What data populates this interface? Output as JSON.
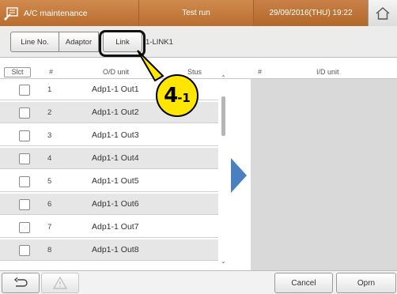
{
  "header": {
    "title": "A/C maintenance",
    "mode": "Test run",
    "datetime": "29/09/2016(THU) 19:22"
  },
  "tabs": {
    "line_no": "Line No.",
    "adaptor": "Adaptor",
    "link": "Link",
    "link_value": "1-LINK1"
  },
  "columns": {
    "slct": "Slct",
    "num": "#",
    "od_unit": "O/D unit",
    "stus": "Stus",
    "num2": "#",
    "id_unit": "I/D unit"
  },
  "rows": [
    {
      "num": "1",
      "unit": "Adp1-1 Out1"
    },
    {
      "num": "2",
      "unit": "Adp1-1 Out2"
    },
    {
      "num": "3",
      "unit": "Adp1-1 Out3"
    },
    {
      "num": "4",
      "unit": "Adp1-1 Out4"
    },
    {
      "num": "5",
      "unit": "Adp1-1 Out5"
    },
    {
      "num": "6",
      "unit": "Adp1-1 Out6"
    },
    {
      "num": "7",
      "unit": "Adp1-1 Out7"
    },
    {
      "num": "8",
      "unit": "Adp1-1 Out8"
    }
  ],
  "footer": {
    "cancel": "Cancel",
    "oprn": "Oprn"
  },
  "callout": {
    "main": "4",
    "sub": "-1"
  },
  "colors": {
    "header_orange": "#c47a3c",
    "arrow_blue": "#4a7fc0",
    "callout_yellow": "#ffe600"
  }
}
